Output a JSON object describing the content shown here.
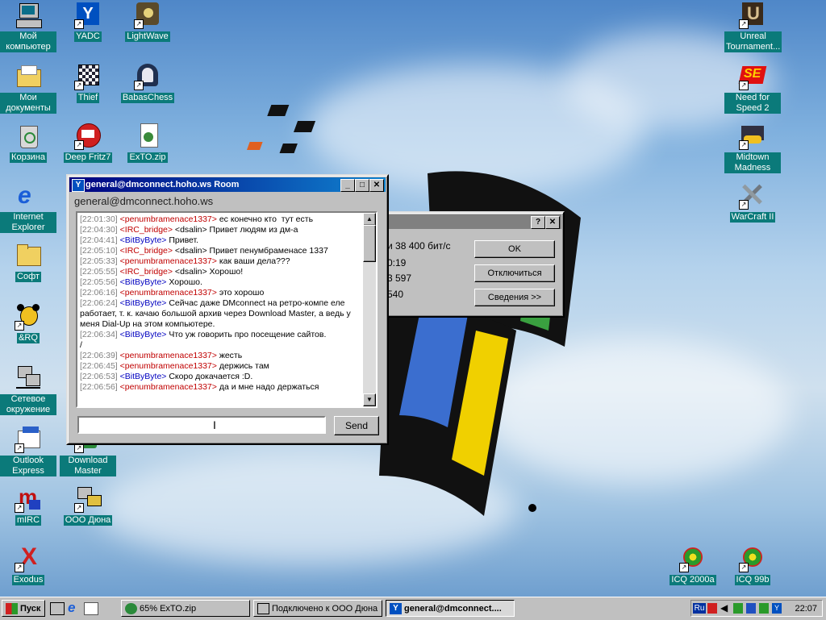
{
  "desktop_icons_left": [
    {
      "label": "Мой компьютер",
      "icon": "my-computer-icon"
    },
    {
      "label": "YADC",
      "icon": "yadc-icon"
    },
    {
      "label": "LightWave",
      "icon": "lightwave-icon"
    },
    {
      "label": "Мои документы",
      "icon": "my-documents-icon"
    },
    {
      "label": "Thief",
      "icon": "thief-icon"
    },
    {
      "label": "BabasChess",
      "icon": "babaschess-icon"
    },
    {
      "label": "Корзина",
      "icon": "recycle-bin-icon"
    },
    {
      "label": "Deep Fritz7",
      "icon": "deep-fritz-icon"
    },
    {
      "label": "ExTO.zip",
      "icon": "zip-icon"
    },
    {
      "label": "Internet Explorer",
      "icon": "ie-icon"
    },
    {
      "label": "Софт",
      "icon": "folder-icon"
    },
    {
      "label": "&RQ",
      "icon": "rq-icon"
    },
    {
      "label": "Сетевое окружение",
      "icon": "network-icon"
    },
    {
      "label": "Outlook Express",
      "icon": "outlook-icon"
    },
    {
      "label": "Download Master",
      "icon": "download-master-icon"
    },
    {
      "label": "mIRC",
      "icon": "mirc-icon"
    },
    {
      "label": "ООО Дюна",
      "icon": "dialup-icon"
    },
    {
      "label": "Exodus",
      "icon": "exodus-icon"
    }
  ],
  "desktop_icons_right": [
    {
      "label": "Unreal Tournament...",
      "icon": "unreal-icon"
    },
    {
      "label": "Need for Speed 2",
      "icon": "nfs-icon"
    },
    {
      "label": "Midtown Madness",
      "icon": "midtown-icon"
    },
    {
      "label": "WarCraft II",
      "icon": "warcraft-icon"
    },
    {
      "label": "ICQ 2000a",
      "icon": "icq-icon"
    },
    {
      "label": "ICQ 99b",
      "icon": "icq-icon"
    }
  ],
  "dialup_window": {
    "speed_text": "и 38 400 бит/с",
    "time_text": "0:19",
    "bytes1": "3 597",
    "bytes2": "540",
    "ok_label": "OK",
    "disconnect_label": "Отключиться",
    "details_label": "Сведения >>"
  },
  "chat_window": {
    "title": "general@dmconnect.hoho.ws Room",
    "room_name": "general@dmconnect.hoho.ws",
    "send_label": "Send",
    "input_value": "",
    "messages": [
      {
        "time": "[22:01:30]",
        "nick": "<penumbramenace1337>",
        "text": " ес конечно кто  тут есть",
        "who": "A"
      },
      {
        "time": "[22:04:30]",
        "nick": "<IRC_bridge>",
        "text": " <dsalin> Привет людям из дм-а",
        "who": "A"
      },
      {
        "time": "[22:04:41]",
        "nick": "<BitByByte>",
        "text": " Привет.",
        "who": "B"
      },
      {
        "time": "[22:05:10]",
        "nick": "<IRC_bridge>",
        "text": " <dsalin> Привет пенумбраменасе 1337",
        "who": "A"
      },
      {
        "time": "[22:05:33]",
        "nick": "<penumbramenace1337>",
        "text": " как ваши дела???",
        "who": "A"
      },
      {
        "time": "[22:05:55]",
        "nick": "<IRC_bridge>",
        "text": " <dsalin> Хорошо!",
        "who": "A"
      },
      {
        "time": "[22:05:56]",
        "nick": "<BitByByte>",
        "text": " Хорошо.",
        "who": "B"
      },
      {
        "time": "[22:06:16]",
        "nick": "<penumbramenace1337>",
        "text": " это хорошо",
        "who": "A"
      },
      {
        "time": "[22:06:24]",
        "nick": "<BitByByte>",
        "text": " Сейчас даже DMconnect на ретро-компе еле работает, т. к. качаю большой архив через Download Master, а ведь у меня Dial-Up на этом компьютере.",
        "who": "B"
      },
      {
        "time": "[22:06:34]",
        "nick": "<BitByByte>",
        "text": " Что уж говорить про посещение сайтов.\n/",
        "who": "B"
      },
      {
        "time": "[22:06:39]",
        "nick": "<penumbramenace1337>",
        "text": " жесть",
        "who": "A"
      },
      {
        "time": "[22:06:45]",
        "nick": "<penumbramenace1337>",
        "text": " держись там",
        "who": "A"
      },
      {
        "time": "[22:06:53]",
        "nick": "<BitByByte>",
        "text": " Скоро докачается :D.",
        "who": "B"
      },
      {
        "time": "[22:06:56]",
        "nick": "<penumbramenace1337>",
        "text": " да и мне надо держаться",
        "who": "A"
      }
    ]
  },
  "taskbar": {
    "start_label": "Пуск",
    "items": [
      {
        "label": "65% ExTO.zip",
        "icon": "download-icon"
      },
      {
        "label": "Подключено к ООО Дюна",
        "icon": "dialup-icon"
      },
      {
        "label": "general@dmconnect....",
        "icon": "yadc-icon"
      }
    ],
    "lang": "Ru",
    "clock": "22:07"
  }
}
